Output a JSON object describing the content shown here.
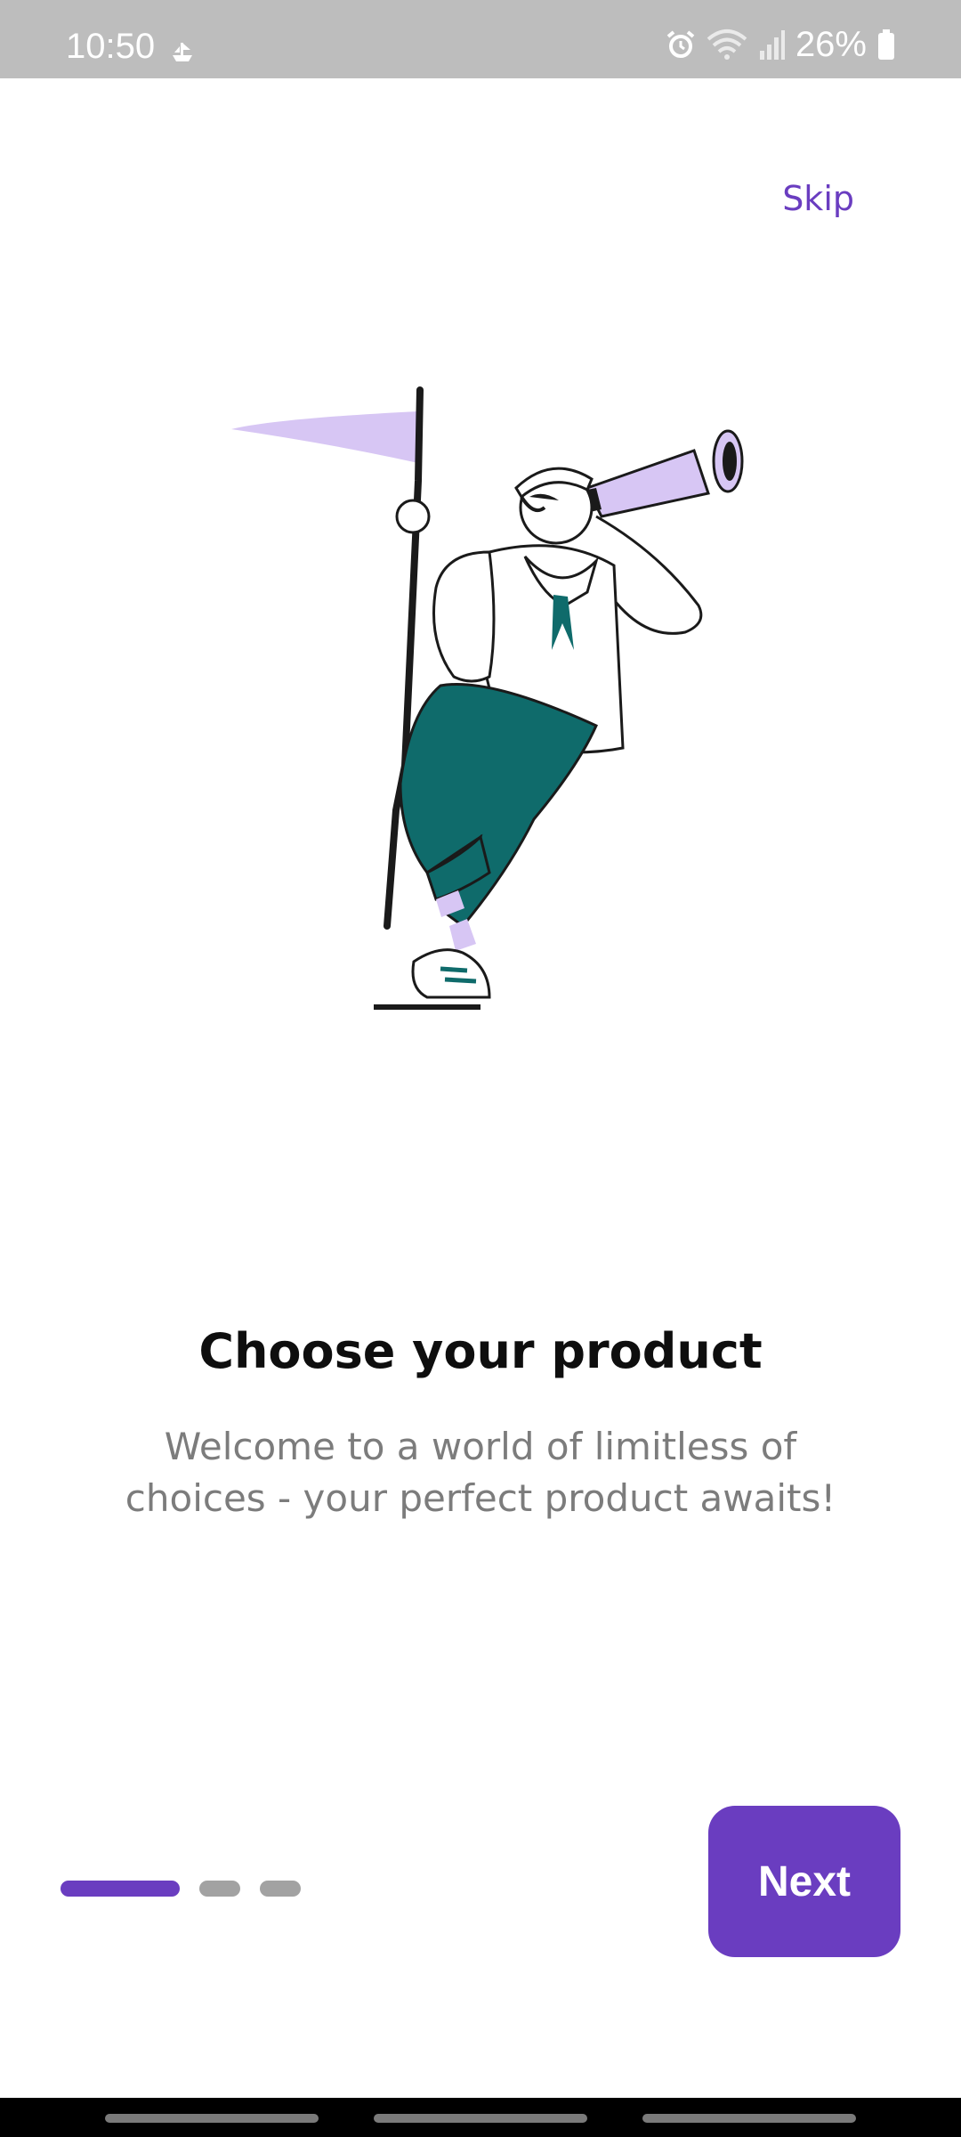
{
  "status_bar": {
    "time": "10:50",
    "notification_icon": "ship-icon",
    "alarm_icon": "alarm-icon",
    "wifi_icon": "wifi-icon",
    "signal_icon": "signal-icon",
    "battery_text": "26%",
    "battery_icon": "battery-icon",
    "bg_color": "#bdbdbd"
  },
  "skip": {
    "label": "Skip",
    "color": "#6a3dc0"
  },
  "illustration": {
    "icon": "sailor-with-telescope-illustration",
    "colors": {
      "purple": "#d7c6f4",
      "teal": "#0f6b6b"
    }
  },
  "content": {
    "title": "Choose your product",
    "subtitle_line1": "Welcome to a world of limitless of",
    "subtitle_line2": "choices - your perfect product awaits!"
  },
  "pager": {
    "total_pages": 3,
    "active_page": 1,
    "active_color": "#6a3dc0",
    "inactive_color": "#a2a2a2"
  },
  "next_button": {
    "label": "Next",
    "color": "#6a3dc0"
  },
  "nav_bar": {
    "bg_color": "#000000"
  }
}
